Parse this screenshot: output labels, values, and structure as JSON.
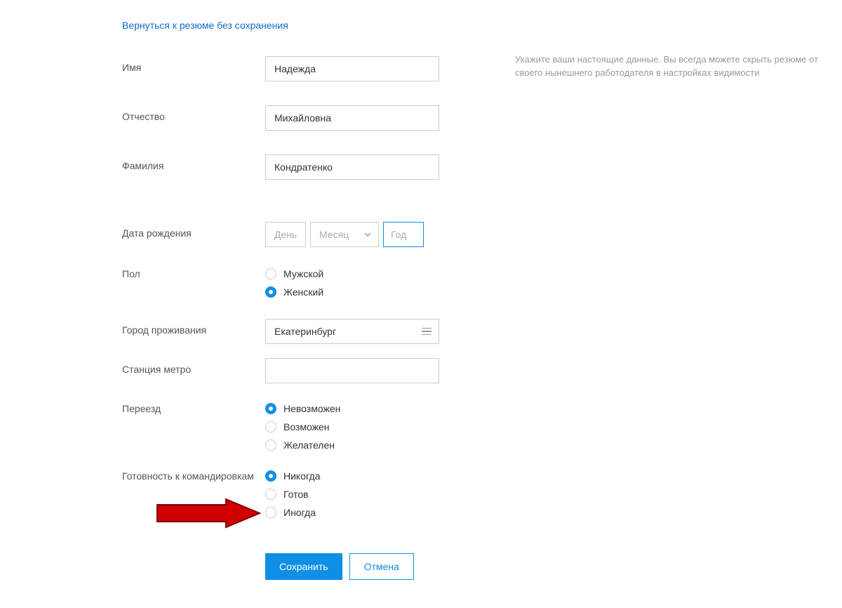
{
  "back_link": "Вернуться к резюме без сохранения",
  "hint": "Укажите ваши настоящие данные. Вы всегда можете скрыть резюме от своего нынешнего работодателя в настройках видимости",
  "fields": {
    "first_name": {
      "label": "Имя",
      "value": "Надежда"
    },
    "patronymic": {
      "label": "Отчество",
      "value": "Михайловна"
    },
    "last_name": {
      "label": "Фамилия",
      "value": "Кондратенко"
    },
    "birth_date": {
      "label": "Дата рождения",
      "day_placeholder": "День",
      "month_placeholder": "Месяц",
      "year_placeholder": "Год"
    },
    "gender": {
      "label": "Пол",
      "options": {
        "male": "Мужской",
        "female": "Женский"
      },
      "selected": "female"
    },
    "city": {
      "label": "Город проживания",
      "value": "Екатеринбург"
    },
    "metro": {
      "label": "Станция метро",
      "value": ""
    },
    "relocation": {
      "label": "Переезд",
      "options": {
        "impossible": "Невозможен",
        "possible": "Возможен",
        "desired": "Желателен"
      },
      "selected": "impossible"
    },
    "trips": {
      "label": "Готовность к командировкам",
      "options": {
        "never": "Никогда",
        "ready": "Готов",
        "sometimes": "Иногда"
      },
      "selected": "never"
    }
  },
  "buttons": {
    "save": "Сохранить",
    "cancel": "Отмена"
  }
}
